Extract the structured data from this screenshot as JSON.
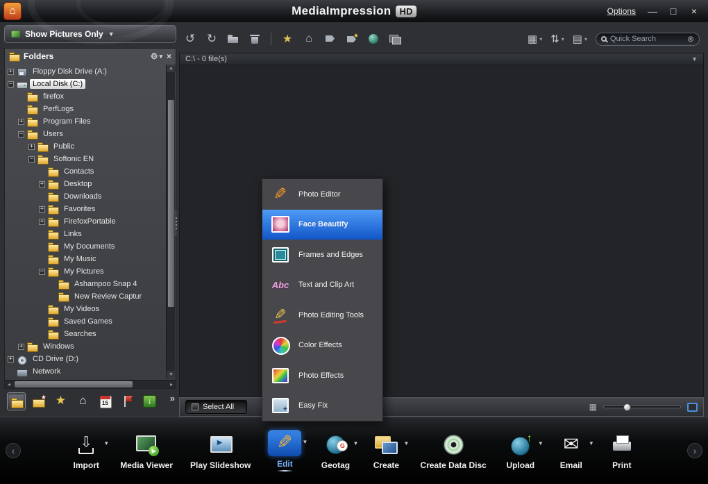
{
  "window": {
    "title": "MediaImpression",
    "badge": "HD",
    "options_label": "Options",
    "controls": [
      {
        "name": "minimize-button",
        "glyph": "—"
      },
      {
        "name": "maximize-button",
        "glyph": "□"
      },
      {
        "name": "close-button",
        "glyph": "×"
      }
    ]
  },
  "sidebar": {
    "filter": {
      "label": "Show Pictures Only"
    },
    "folders_panel": {
      "title": "Folders"
    },
    "tree": [
      {
        "label": "Floppy Disk Drive (A:)",
        "depth": 0,
        "toggle": "plus",
        "icon": "floppy-drive-icon"
      },
      {
        "label": "Local Disk (C:)",
        "depth": 0,
        "toggle": "minus",
        "icon": "hard-drive-icon",
        "selected": true
      },
      {
        "label": "firefox",
        "depth": 1,
        "toggle": "none",
        "icon": "folder-icon"
      },
      {
        "label": "PerfLogs",
        "depth": 1,
        "toggle": "none",
        "icon": "folder-icon"
      },
      {
        "label": "Program Files",
        "depth": 1,
        "toggle": "plus",
        "icon": "folder-icon"
      },
      {
        "label": "Users",
        "depth": 1,
        "toggle": "minus",
        "icon": "folder-icon"
      },
      {
        "label": "Public",
        "depth": 2,
        "toggle": "plus",
        "icon": "folder-icon"
      },
      {
        "label": "Softonic EN",
        "depth": 2,
        "toggle": "minus",
        "icon": "folder-icon"
      },
      {
        "label": "Contacts",
        "depth": 3,
        "toggle": "none",
        "icon": "folder-icon"
      },
      {
        "label": "Desktop",
        "depth": 3,
        "toggle": "plus",
        "icon": "folder-icon"
      },
      {
        "label": "Downloads",
        "depth": 3,
        "toggle": "none",
        "icon": "folder-icon"
      },
      {
        "label": "Favorites",
        "depth": 3,
        "toggle": "plus",
        "icon": "folder-icon"
      },
      {
        "label": "FirefoxPortable",
        "depth": 3,
        "toggle": "plus",
        "icon": "folder-icon"
      },
      {
        "label": "Links",
        "depth": 3,
        "toggle": "none",
        "icon": "folder-icon"
      },
      {
        "label": "My Documents",
        "depth": 3,
        "toggle": "none",
        "icon": "folder-icon"
      },
      {
        "label": "My Music",
        "depth": 3,
        "toggle": "none",
        "icon": "folder-icon"
      },
      {
        "label": "My Pictures",
        "depth": 3,
        "toggle": "minus",
        "icon": "folder-icon"
      },
      {
        "label": "Ashampoo Snap 4",
        "depth": 4,
        "toggle": "none",
        "icon": "folder-icon"
      },
      {
        "label": "New Review Captur",
        "depth": 4,
        "toggle": "none",
        "icon": "folder-icon"
      },
      {
        "label": "My Videos",
        "depth": 3,
        "toggle": "none",
        "icon": "folder-icon"
      },
      {
        "label": "Saved Games",
        "depth": 3,
        "toggle": "none",
        "icon": "folder-icon"
      },
      {
        "label": "Searches",
        "depth": 3,
        "toggle": "none",
        "icon": "folder-icon"
      },
      {
        "label": "Windows",
        "depth": 1,
        "toggle": "plus",
        "icon": "folder-icon"
      },
      {
        "label": "CD Drive (D:)",
        "depth": 0,
        "toggle": "plus",
        "icon": "cd-drive-icon"
      },
      {
        "label": "Network",
        "depth": 0,
        "toggle": "none",
        "icon": "network-icon"
      }
    ],
    "bottom_icons": [
      {
        "name": "folders-view-icon",
        "active": true
      },
      {
        "name": "favorite-folders-icon"
      },
      {
        "name": "ratings-view-icon"
      },
      {
        "name": "library-view-icon"
      },
      {
        "name": "calendar-view-icon",
        "text": "15"
      },
      {
        "name": "tags-view-icon"
      },
      {
        "name": "import-status-icon"
      }
    ],
    "more_label": "»"
  },
  "content": {
    "toolbar": {
      "left_icons": [
        "rotate-left-icon",
        "rotate-right-icon",
        "move-to-folder-icon",
        "delete-icon",
        "separator",
        "rating-star-icon",
        "home-tag-icon",
        "tag-icon",
        "tag-star-icon",
        "face-tag-icon",
        "stack-photos-icon"
      ],
      "right_buttons": [
        {
          "name": "thumbnail-view-button",
          "icon": "grid-view-icon",
          "glyph": "▦"
        },
        {
          "name": "sort-button",
          "icon": "sort-icon",
          "glyph": "⇅"
        },
        {
          "name": "details-view-button",
          "icon": "details-view-icon",
          "glyph": "▤"
        }
      ],
      "search": {
        "placeholder": "Quick Search"
      }
    },
    "path_bar": {
      "text": "C:\\ - 0 file(s)"
    },
    "status_bar": {
      "select_all_label": "Select All"
    }
  },
  "edit_menu": {
    "items": [
      {
        "label": "Photo Editor",
        "icon": "photo-editor-icon"
      },
      {
        "label": "Face Beautify",
        "icon": "face-beautify-icon",
        "selected": true
      },
      {
        "label": "Frames and Edges",
        "icon": "frames-edges-icon"
      },
      {
        "label": "Text and Clip Art",
        "icon": "text-clipart-icon"
      },
      {
        "label": "Photo Editing Tools",
        "icon": "photo-editing-tools-icon"
      },
      {
        "label": "Color Effects",
        "icon": "color-effects-icon"
      },
      {
        "label": "Photo Effects",
        "icon": "photo-effects-icon"
      },
      {
        "label": "Easy Fix",
        "icon": "easy-fix-icon"
      }
    ]
  },
  "bottom_toolbar": {
    "items": [
      {
        "label": "Import",
        "icon": "import-icon",
        "dropdown": true
      },
      {
        "label": "Media Viewer",
        "icon": "media-viewer-icon",
        "dropdown": false
      },
      {
        "label": "Play Slideshow",
        "icon": "play-slideshow-icon",
        "dropdown": false
      },
      {
        "label": "Edit",
        "icon": "edit-icon",
        "dropdown": true,
        "active": true
      },
      {
        "label": "Geotag",
        "icon": "geotag-icon",
        "dropdown": true
      },
      {
        "label": "Create",
        "icon": "create-icon",
        "dropdown": true
      },
      {
        "label": "Create Data Disc",
        "icon": "create-data-disc-icon",
        "dropdown": false
      },
      {
        "label": "Upload",
        "icon": "upload-icon",
        "dropdown": true
      },
      {
        "label": "Email",
        "icon": "email-icon",
        "dropdown": true
      },
      {
        "label": "Print",
        "icon": "print-icon",
        "dropdown": false
      }
    ]
  },
  "colors": {
    "accent_blue": "#1f6fd4",
    "selection_gradient_top": "#4f9bf6",
    "selection_gradient_bottom": "#1156c8",
    "folder_yellow": "#e8c24a"
  }
}
